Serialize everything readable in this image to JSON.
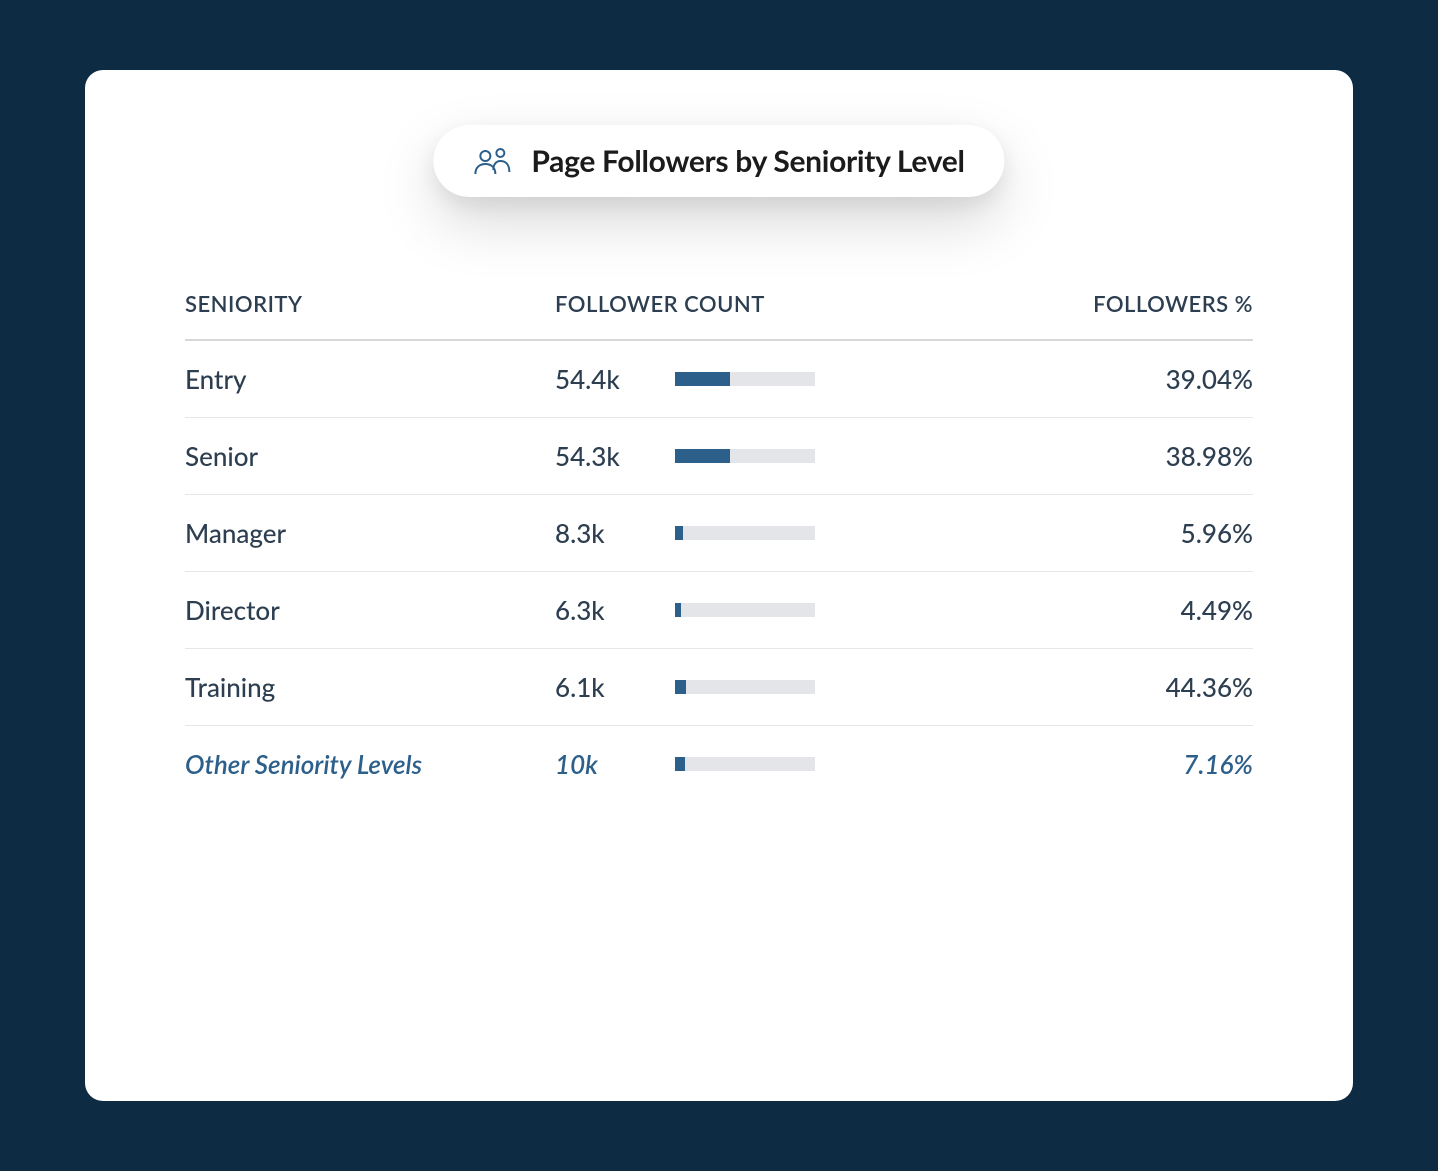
{
  "card": {
    "title": "Page Followers by Seniority Level",
    "headers": {
      "seniority": "SENIORITY",
      "count": "FOLLOWER COUNT",
      "percent": "FOLLOWERS %"
    },
    "rows": [
      {
        "label": "Entry",
        "count": "54.4k",
        "percent": "39.04%",
        "bar_pct": 39.04,
        "other": false
      },
      {
        "label": "Senior",
        "count": "54.3k",
        "percent": "38.98%",
        "bar_pct": 38.98,
        "other": false
      },
      {
        "label": "Manager",
        "count": "8.3k",
        "percent": "5.96%",
        "bar_pct": 5.96,
        "other": false
      },
      {
        "label": "Director",
        "count": "6.3k",
        "percent": "4.49%",
        "bar_pct": 4.49,
        "other": false
      },
      {
        "label": "Training",
        "count": "6.1k",
        "percent": "44.36%",
        "bar_pct": 8.0,
        "other": false
      },
      {
        "label": "Other Seniority Levels",
        "count": "10k",
        "percent": "7.16%",
        "bar_pct": 7.16,
        "other": true
      }
    ]
  },
  "chart_data": {
    "type": "bar",
    "title": "Page Followers by Seniority Level",
    "categories": [
      "Entry",
      "Senior",
      "Manager",
      "Director",
      "Training",
      "Other Seniority Levels"
    ],
    "series": [
      {
        "name": "Follower Count",
        "values_label": [
          "54.4k",
          "54.3k",
          "8.3k",
          "6.3k",
          "6.1k",
          "10k"
        ],
        "values": [
          54400,
          54300,
          8300,
          6300,
          6100,
          10000
        ]
      },
      {
        "name": "Followers %",
        "values_label": [
          "39.04%",
          "38.98%",
          "5.96%",
          "4.49%",
          "44.36%",
          "7.16%"
        ],
        "values": [
          39.04,
          38.98,
          5.96,
          4.49,
          44.36,
          7.16
        ]
      }
    ],
    "xlabel": "Follower Count",
    "ylabel": "Seniority",
    "xlim": [
      0,
      100
    ]
  }
}
